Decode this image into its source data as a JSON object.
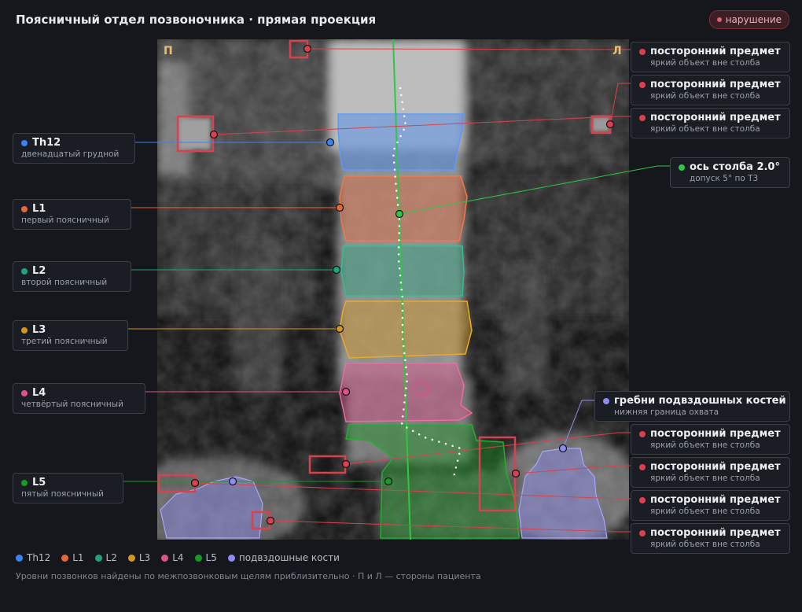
{
  "title": "Поясничный отдел позвоночника · прямая проекция",
  "badge": "нарушение",
  "side_right_patient": "П",
  "side_left_patient": "Л",
  "colors": {
    "Th12": "#3b82f6",
    "L1": "#e8673a",
    "L2": "#21a37a",
    "L3": "#d4961e",
    "L4": "#e0508c",
    "L5": "#179b23",
    "iliac": "#8e8cf0",
    "foreign": "#d9414e"
  },
  "vertebrae": [
    {
      "id": "Th12",
      "name": "Th12",
      "desc": "двенадцатый грудной",
      "color": "#3b82f6"
    },
    {
      "id": "L1",
      "name": "L1",
      "desc": "первый поясничный",
      "color": "#e8673a"
    },
    {
      "id": "L2",
      "name": "L2",
      "desc": "второй поясничный",
      "color": "#21a37a"
    },
    {
      "id": "L3",
      "name": "L3",
      "desc": "третий поясничный",
      "color": "#d4961e"
    },
    {
      "id": "L4",
      "name": "L4",
      "desc": "четвёртый поясничный",
      "color": "#e0508c"
    },
    {
      "id": "L5",
      "name": "L5",
      "desc": "пятый поясничный",
      "color": "#179b23"
    }
  ],
  "axis": {
    "name": "ось столба 2.0°",
    "desc": "допуск 5° по Т3",
    "color": "#2fb34a"
  },
  "iliac": {
    "name": "гребни подвздошных костей",
    "desc": "нижняя граница охвата",
    "color": "#8e8cf0"
  },
  "foreign": {
    "name": "посторонний предмет",
    "desc": "яркий объект вне столба",
    "count": 7
  },
  "legend": [
    {
      "label": "Th12",
      "color": "#3b82f6"
    },
    {
      "label": "L1",
      "color": "#e8673a"
    },
    {
      "label": "L2",
      "color": "#21a37a"
    },
    {
      "label": "L3",
      "color": "#d4961e"
    },
    {
      "label": "L4",
      "color": "#e0508c"
    },
    {
      "label": "L5",
      "color": "#179b23"
    },
    {
      "label": "подвздошные кости",
      "color": "#8e8cf0"
    }
  ],
  "footnote": "Уровни позвонков найдены по межпозвонковым щелям приблизительно · П и Л — стороны пациента"
}
